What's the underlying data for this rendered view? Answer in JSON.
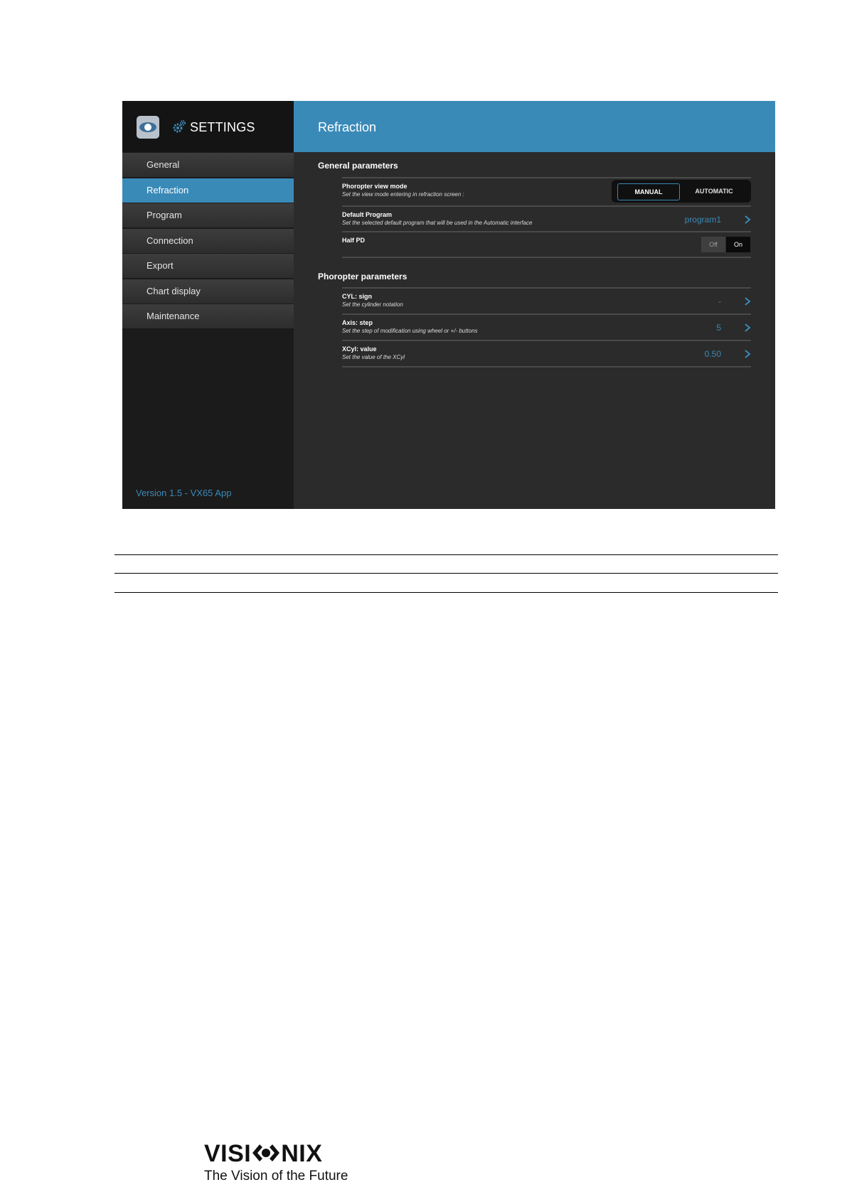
{
  "sidebar": {
    "title": "SETTINGS",
    "items": [
      {
        "label": "General"
      },
      {
        "label": "Refraction"
      },
      {
        "label": "Program"
      },
      {
        "label": "Connection"
      },
      {
        "label": "Export"
      },
      {
        "label": "Chart display"
      },
      {
        "label": "Maintenance"
      }
    ],
    "selected": "Refraction",
    "version": "Version 1.5 - VX65 App"
  },
  "main": {
    "title": "Refraction",
    "general": {
      "title": "General parameters",
      "view_mode": {
        "label": "Phoropter view mode",
        "desc": "Set the view mode entering in refraction screen :",
        "options": [
          "MANUAL",
          "AUTOMATIC"
        ],
        "selected": "MANUAL"
      },
      "default_program": {
        "label": "Default Program",
        "desc": "Set the selected default program that will be used in the Automatic interface",
        "value": "program1"
      },
      "half_pd": {
        "label": "Half PD",
        "options": [
          "Off",
          "On"
        ],
        "selected": "On"
      }
    },
    "phoropter": {
      "title": "Phoropter parameters",
      "cyl_sign": {
        "label": "CYL: sign",
        "desc": "Set the cylinder notation",
        "value": "-"
      },
      "axis_step": {
        "label": "Axis: step",
        "desc": "Set the step of modification using wheel or +/- buttons",
        "value": "5"
      },
      "xcyl_value": {
        "label": "XCyl: value",
        "desc": "Set the value of the XCyl",
        "value": "0.50"
      }
    }
  },
  "brand": {
    "name_left": "VISI",
    "name_right": "NIX",
    "tagline": "The Vision of the Future"
  },
  "colors": {
    "accent": "#3a8ab8",
    "sidebar": "#1b1b1b",
    "content": "#2b2b2b"
  }
}
